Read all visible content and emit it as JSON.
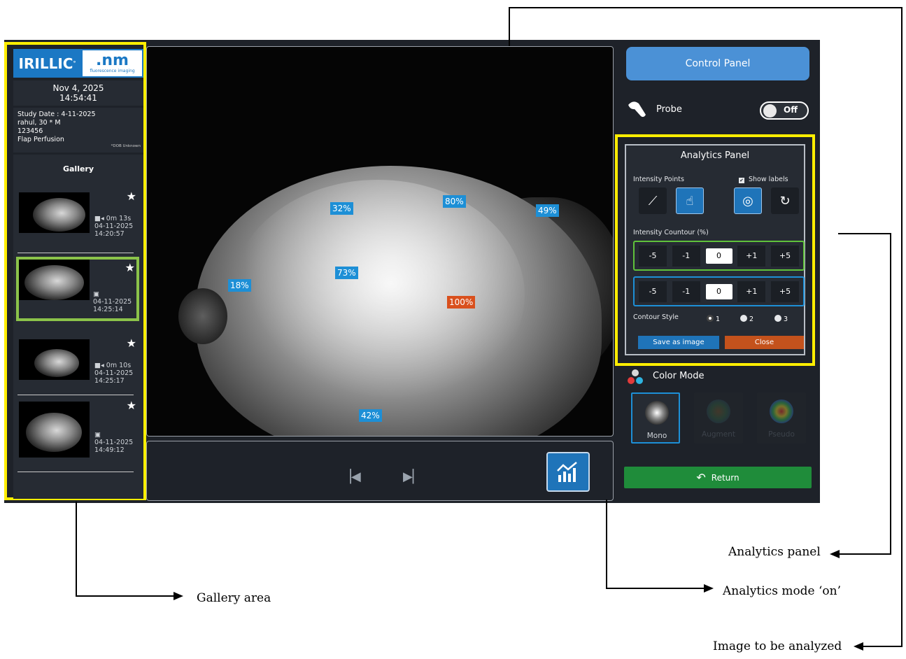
{
  "logo": {
    "brand": "IRILLIC",
    "product": ".nm",
    "product_tagline": "fluorescence imaging"
  },
  "header": {
    "date": "Nov 4, 2025",
    "time": "14:54:41"
  },
  "study": {
    "study_date": "Study Date : 4-11-2025",
    "patient": "rahul, 30 * M",
    "patient_id": "123456",
    "procedure": "Flap Perfusion",
    "dob_note": "*DOB Unknown"
  },
  "gallery": {
    "title": "Gallery",
    "items": [
      {
        "type": "video",
        "duration": "0m 13s",
        "date": "04-11-2025",
        "time": "14:20:57",
        "selected": false
      },
      {
        "type": "image",
        "duration": "",
        "date": "04-11-2025",
        "time": "14:25:14",
        "selected": true
      },
      {
        "type": "video",
        "duration": "0m 10s",
        "date": "04-11-2025",
        "time": "14:25:17",
        "selected": false
      },
      {
        "type": "image",
        "duration": "",
        "date": "04-11-2025",
        "time": "14:49:12",
        "selected": false
      }
    ]
  },
  "viewer": {
    "points": [
      {
        "label": "32%",
        "hot": false
      },
      {
        "label": "80%",
        "hot": false
      },
      {
        "label": "49%",
        "hot": false
      },
      {
        "label": "73%",
        "hot": false
      },
      {
        "label": "18%",
        "hot": false
      },
      {
        "label": "100%",
        "hot": true
      },
      {
        "label": "42%",
        "hot": false
      }
    ]
  },
  "control_panel": {
    "label": "Control Panel"
  },
  "probe": {
    "label": "Probe",
    "state": "Off"
  },
  "analytics_panel": {
    "title": "Analytics Panel",
    "intensity_points_label": "Intensity Points",
    "show_labels_label": "Show labels",
    "show_labels_checked": true,
    "contour_label": "Intensity Countour (%)",
    "contour_rows": [
      {
        "minus5": "-5",
        "minus1": "-1",
        "value": "0",
        "plus1": "+1",
        "plus5": "+5"
      },
      {
        "minus5": "-5",
        "minus1": "-1",
        "value": "0",
        "plus1": "+1",
        "plus5": "+5"
      }
    ],
    "style_label": "Contour Style",
    "style_options": [
      "1",
      "2",
      "3"
    ],
    "style_selected": "1",
    "save_label": "Save as image",
    "close_label": "Close"
  },
  "color_mode": {
    "label": "Color Mode",
    "options": [
      {
        "label": "Mono",
        "active": true
      },
      {
        "label": "Augment",
        "active": false
      },
      {
        "label": "Pseudo",
        "active": false
      }
    ]
  },
  "return": {
    "label": "Return"
  },
  "annotations": {
    "gallery_area": "Gallery area",
    "analytics_mode": "Analytics mode ‘on’",
    "analytics_panel": "Analytics panel",
    "image_to_analyze": "Image to be analyzed"
  },
  "colors": {
    "highlight": "#ffee00",
    "accent_blue": "#1d8fd6",
    "hot_orange": "#d9501d",
    "selected_green": "#8bc34a",
    "return_green": "#1f8c3a"
  }
}
